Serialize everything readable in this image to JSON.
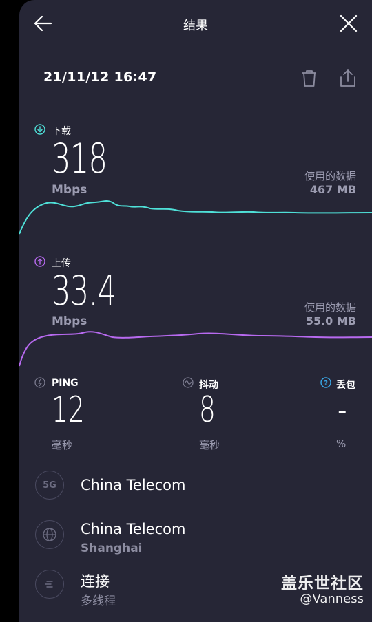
{
  "header": {
    "title": "结果",
    "datetime": "21/11/12 16:47"
  },
  "download": {
    "label": "下载",
    "value": "318",
    "unit": "Mbps",
    "data_used_label": "使用的数据",
    "data_used_value": "467 MB",
    "color": "#4fe0d8"
  },
  "upload": {
    "label": "上传",
    "value": "33.4",
    "unit": "Mbps",
    "data_used_label": "使用的数据",
    "data_used_value": "55.0 MB",
    "color": "#b86af0"
  },
  "stats": {
    "ping": {
      "label": "PING",
      "value": "12",
      "unit": "毫秒"
    },
    "jitter": {
      "label": "抖动",
      "value": "8",
      "unit": "毫秒"
    },
    "loss": {
      "label": "丢包",
      "value": "-",
      "unit": "%"
    }
  },
  "info": {
    "provider": {
      "badge": "5G",
      "name": "China Telecom"
    },
    "server": {
      "name": "China Telecom",
      "location": "Shanghai"
    },
    "connection": {
      "label": "连接",
      "mode": "多线程"
    }
  },
  "watermark": {
    "line1": "盖乐世社区",
    "line2": "@Vanness"
  }
}
